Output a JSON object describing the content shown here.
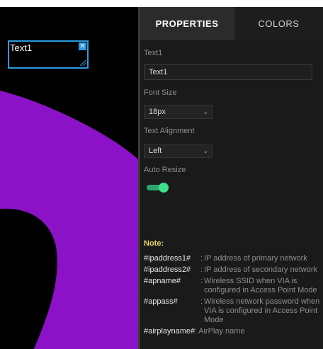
{
  "canvas": {
    "element_text": "Text1",
    "close_icon": "close-icon",
    "ring_color": "#8b12c7",
    "background_color": "#000000"
  },
  "tabs": [
    {
      "label": "PROPERTIES",
      "active": true
    },
    {
      "label": "COLORS",
      "active": false
    }
  ],
  "properties": {
    "text_label": "Text1",
    "text_value": "Text1",
    "font_size_label": "Font Size",
    "font_size_value": "18px",
    "alignment_label": "Text Alignment",
    "alignment_value": "Left",
    "auto_resize_label": "Auto Resize",
    "auto_resize_on": true,
    "toggle_color": "#3ee08a"
  },
  "note": {
    "title": "Note:",
    "items": [
      {
        "key": "#ipaddress1#",
        "value": "IP address of primary network"
      },
      {
        "key": "#ipaddress2#",
        "value": "IP address of secondary network"
      },
      {
        "key": "#apname#",
        "value": "Wireless SSID when VIA is configured in Access Point Mode"
      },
      {
        "key": "#appass#",
        "value": "Wireless network password when VIA is configured in Access Point Mode"
      },
      {
        "key": "#airplayname#",
        "value": "AirPlay name"
      }
    ]
  }
}
